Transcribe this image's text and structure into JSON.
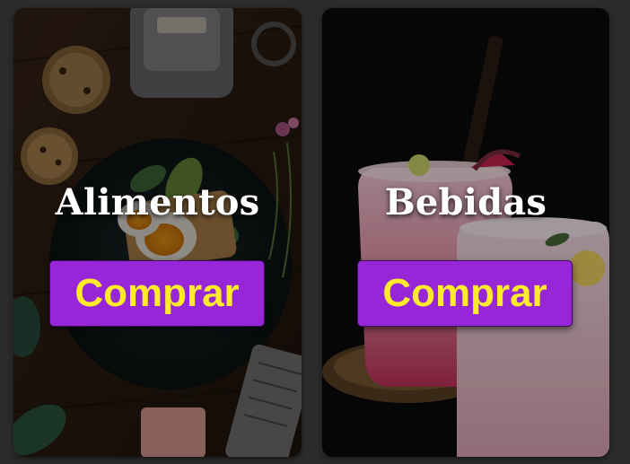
{
  "cards": [
    {
      "title": "Alimentos",
      "button_label": "Comprar",
      "image": "food-photo"
    },
    {
      "title": "Bebidas",
      "button_label": "Comprar",
      "image": "drinks-photo"
    }
  ],
  "colors": {
    "page_background": "#2b2b2b",
    "button_background": "#9826d9",
    "button_text": "#ffeb2a",
    "title_text": "#ffffff"
  }
}
